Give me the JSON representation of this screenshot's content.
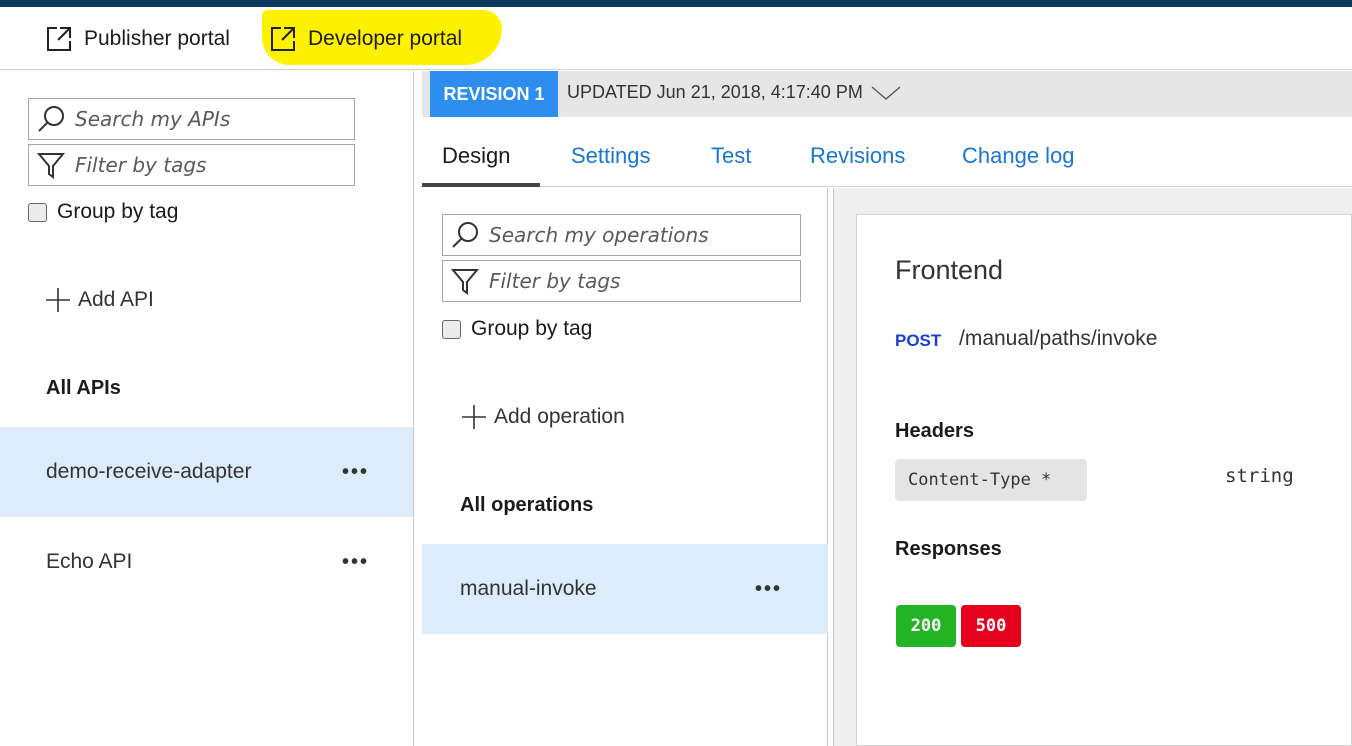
{
  "portal_bar": {
    "publisher_label": "Publisher portal",
    "developer_label": "Developer portal"
  },
  "api_pane": {
    "search_placeholder": "Search my APIs",
    "filter_placeholder": "Filter by tags",
    "group_by_tag_label": "Group by tag",
    "add_label": "Add API",
    "section_title": "All APIs",
    "apis": [
      {
        "name": "demo-receive-adapter",
        "selected": true,
        "more": "•••"
      },
      {
        "name": "Echo API",
        "selected": false,
        "more": "•••"
      }
    ]
  },
  "revision_bar": {
    "badge": "REVISION 1",
    "updated": "UPDATED Jun 21, 2018, 4:17:40 PM"
  },
  "tabs": [
    {
      "label": "Design",
      "active": true
    },
    {
      "label": "Settings",
      "active": false
    },
    {
      "label": "Test",
      "active": false
    },
    {
      "label": "Revisions",
      "active": false
    },
    {
      "label": "Change log",
      "active": false
    }
  ],
  "ops_pane": {
    "search_placeholder": "Search my operations",
    "filter_placeholder": "Filter by tags",
    "group_by_tag_label": "Group by tag",
    "add_label": "Add operation",
    "section_title": "All operations",
    "operations": [
      {
        "name": "manual-invoke",
        "selected": true,
        "more": "•••"
      }
    ]
  },
  "frontend": {
    "title": "Frontend",
    "method": "POST",
    "path": "/manual/paths/invoke",
    "headers_title": "Headers",
    "header_name": "Content-Type *",
    "header_type": "string",
    "responses_title": "Responses",
    "responses": [
      {
        "code": "200",
        "color": "#22b422"
      },
      {
        "code": "500",
        "color": "#e5001b"
      }
    ]
  },
  "colors": {
    "accent": "#1a76d2",
    "revision_badge": "#2d8ef0",
    "selected_row": "#dcecfb",
    "highlight": "#fff200",
    "topbar": "#0d3a5c"
  }
}
